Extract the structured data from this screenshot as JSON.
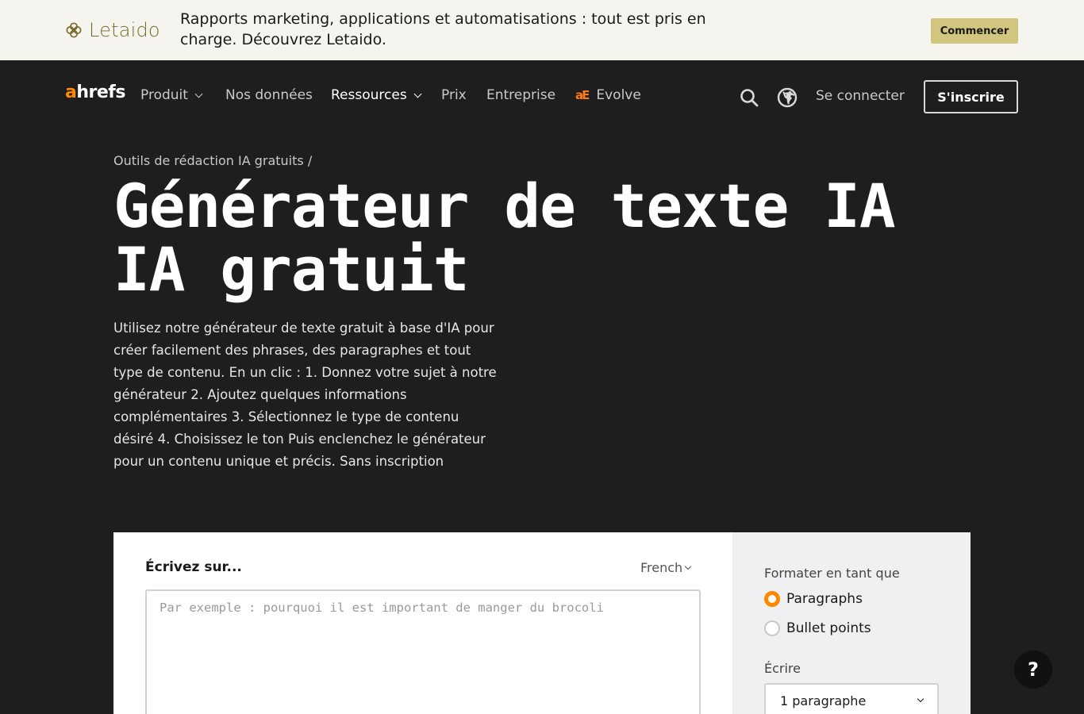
{
  "promo": {
    "logo_text": "Letaido",
    "message": "Rapports marketing, applications et automatisations : tout est pris en charge. Découvrez Letaido.",
    "cta_label": "Commencer"
  },
  "nav": {
    "brand_a": "a",
    "brand_rest": "hrefs",
    "items": [
      {
        "label": "Produit"
      },
      {
        "label": "Nos données"
      },
      {
        "label": "Ressources"
      },
      {
        "label": "Prix"
      },
      {
        "label": "Entreprise"
      },
      {
        "label": "Evolve"
      }
    ],
    "evolve_mark": "aE",
    "login_label": "Se connecter",
    "signup_label": "S'inscrire"
  },
  "hero": {
    "breadcrumb": "Outils de rédaction IA gratuits /",
    "title": "Générateur de texte IA IA gratuit",
    "description": "Utilisez notre générateur de texte gratuit à base d'IA pour créer facilement des phrases, des paragraphes et tout type de contenu. En un clic : 1. Donnez votre sujet à notre générateur 2. Ajoutez quelques informations complémentaires 3. Sélectionnez le type de contenu désiré 4. Choisissez le ton Puis enclenchez le générateur pour un contenu unique et précis. Sans inscription"
  },
  "tool": {
    "write_label": "Écrivez sur...",
    "language": "French",
    "topic_placeholder": "Par exemple : pourquoi il est important de manger du brocoli",
    "format_label": "Formater en tant que",
    "format_options": [
      {
        "label": "Paragraphs",
        "selected": true
      },
      {
        "label": "Bullet points",
        "selected": false
      }
    ],
    "length_label": "Écrire",
    "length_value": "1 paragraphe"
  },
  "help_label": "?",
  "colors": {
    "accent": "#ff8800",
    "promo_bg": "#f6f4ef",
    "promo_cta": "#d1c67d",
    "dark_bg": "#1e1e1e"
  },
  "icons": [
    "letaido-logo-icon",
    "search-icon",
    "globe-icon",
    "chevron-down-icon",
    "help-icon"
  ]
}
